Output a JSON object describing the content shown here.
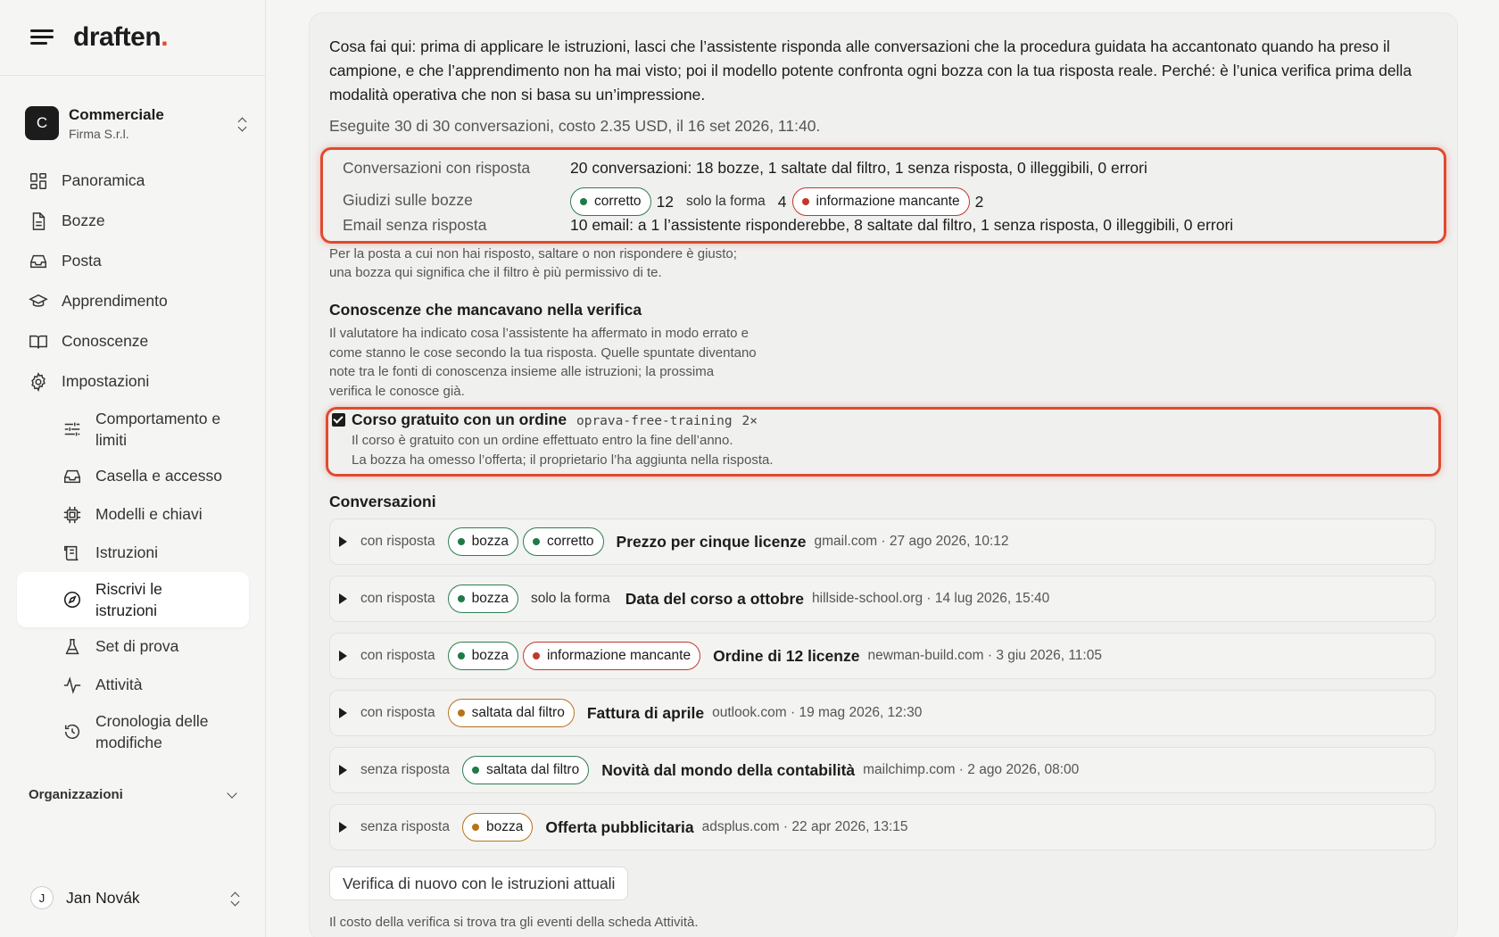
{
  "brand": {
    "logo": "draften",
    "logo_dot": "."
  },
  "org": {
    "initial": "C",
    "name": "Commerciale",
    "sub": "Firma S.r.l."
  },
  "nav": [
    {
      "label": "Panoramica",
      "icon": "grid-icon"
    },
    {
      "label": "Bozze",
      "icon": "document-icon"
    },
    {
      "label": "Posta",
      "icon": "inbox-icon"
    },
    {
      "label": "Apprendimento",
      "icon": "graduation-cap-icon"
    },
    {
      "label": "Conoscenze",
      "icon": "book-icon"
    },
    {
      "label": "Impostazioni",
      "icon": "gear-icon"
    }
  ],
  "subnav": [
    {
      "label_1": "Comportamento e",
      "label_2": "limiti",
      "icon": "sliders-icon"
    },
    {
      "label_1": "Casella e accesso",
      "icon": "inbox-icon"
    },
    {
      "label_1": "Modelli e chiavi",
      "icon": "chip-icon"
    },
    {
      "label_1": "Istruzioni",
      "icon": "scroll-icon"
    },
    {
      "label_1": "Riscrivi le",
      "label_2": "istruzioni",
      "icon": "compass-icon",
      "active": true
    },
    {
      "label_1": "Set di prova",
      "icon": "flask-icon"
    },
    {
      "label_1": "Attività",
      "icon": "activity-icon"
    },
    {
      "label_1": "Cronologia delle",
      "label_2": "modifiche",
      "icon": "history-icon"
    }
  ],
  "orgs_header": "Organizzazioni",
  "user": {
    "initial": "J",
    "name": "Jan Novák"
  },
  "intro": "Cosa fai qui: prima di applicare le istruzioni, lasci che l’assistente risponda alle conversazioni che la procedura guidata ha accantonato quando ha preso il campione, e che l’apprendimento non ha mai visto; poi il modello potente confronta ogni bozza con la tua risposta reale. Perché: è l’unica verifica prima della modalità operativa che non si basa su un’impressione.",
  "run_meta": "Eseguite 30 di 30 conversazioni, costo 2.35 USD, il 16 set 2026, 11:40.",
  "stats": {
    "answered_label": "Conversazioni con risposta",
    "answered_value": "20 conversazioni: 18 bozze, 1 saltate dal filtro, 1 senza risposta, 0 illeggibili, 0 errori",
    "verdicts_label": "Giudizi sulle bozze",
    "verdict_correct": "corretto",
    "verdict_correct_count": "12",
    "verdict_form": "solo la forma",
    "verdict_form_count": "4",
    "verdict_missing": "informazione mancante",
    "verdict_missing_count": "2",
    "unanswered_label": "Email senza risposta",
    "unanswered_value": "10 email: a 1 l’assistente risponderebbe, 8 saltate dal filtro, 1 senza risposta, 0 illeggibili, 0 errori"
  },
  "note_1": "Per la posta a cui non hai risposto, saltare o non rispondere è giusto;",
  "note_2": "una bozza qui significa che il filtro è più permissivo di te.",
  "knowledge_section": {
    "title": "Conoscenze che mancavano nella verifica",
    "desc_1": "Il valutatore ha indicato cosa l’assistente ha affermato in modo errato e",
    "desc_2": "come stanno le cose secondo la tua risposta. Quelle spuntate diventano",
    "desc_3": "note tra le fonti di conoscenza insieme alle istruzioni; la prossima",
    "desc_4": "verifica le conosce già.",
    "item_title": "Corso gratuito con un ordine",
    "item_code": "oprava-free-training",
    "item_count": "2×",
    "item_line_1": "Il corso è gratuito con un ordine effettuato entro la fine dell’anno.",
    "item_line_2": "La bozza ha omesso l’offerta; il proprietario l’ha aggiunta nella risposta."
  },
  "conversations_title": "Conversazioni",
  "conversations": [
    {
      "status": "con risposta",
      "tag1": "bozza",
      "tag2": "corretto",
      "subject": "Prezzo per cinque licenze",
      "meta": "gmail.com · 27 ago 2026, 10:12"
    },
    {
      "status": "con risposta",
      "tag1": "bozza",
      "plain": "solo la forma",
      "subject": "Data del corso a ottobre",
      "meta": "hillside-school.org · 14 lug 2026, 15:40"
    },
    {
      "status": "con risposta",
      "tag1": "bozza",
      "tag2": "informazione mancante",
      "subject": "Ordine di 12 licenze",
      "meta": "newman-build.com · 3 giu 2026, 11:05"
    },
    {
      "status": "con risposta",
      "tag1": "saltata dal filtro",
      "subject": "Fattura di aprile",
      "meta": "outlook.com · 19 mag 2026, 12:30"
    },
    {
      "status": "senza risposta",
      "tag1": "saltata dal filtro",
      "subject": "Novità dal mondo della contabilità",
      "meta": "mailchimp.com · 2 ago 2026, 08:00"
    },
    {
      "status": "senza risposta",
      "tag1": "bozza",
      "subject": "Offerta pubblicitaria",
      "meta": "adsplus.com · 22 apr 2026, 13:15"
    }
  ],
  "recheck_button": "Verifica di nuovo con le istruzioni attuali",
  "footer_note": "Il costo della verifica si trova tra gli eventi della scheda Attività."
}
